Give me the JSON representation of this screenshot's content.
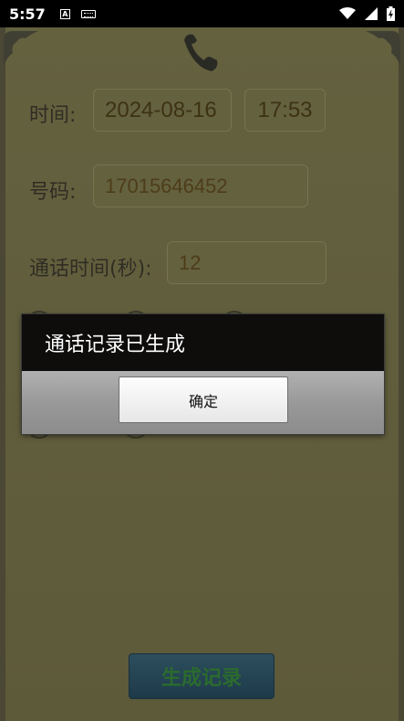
{
  "status_bar": {
    "time": "5:57",
    "icons": [
      "a-notification-icon",
      "keyboard-icon",
      "wifi-icon",
      "cellular-icon",
      "battery-icon"
    ]
  },
  "form": {
    "time_label": "时间:",
    "date_value": "2024-08-16",
    "time_value": "17:53",
    "number_label": "号码:",
    "number_value": "17015646452",
    "duration_label": "通话时间(秒):",
    "duration_value": "12"
  },
  "generate_button_label": "生成记录",
  "dialog": {
    "title": "通话记录已生成",
    "ok_label": "确定"
  },
  "colors": {
    "paper": "#5f5c3e",
    "dialog_title_bg": "#0e0d0c",
    "dialog_body_bg": "#9e9e9e",
    "generate_button_bg": "#1e3a4a",
    "generate_button_text": "#2b6b2e"
  }
}
